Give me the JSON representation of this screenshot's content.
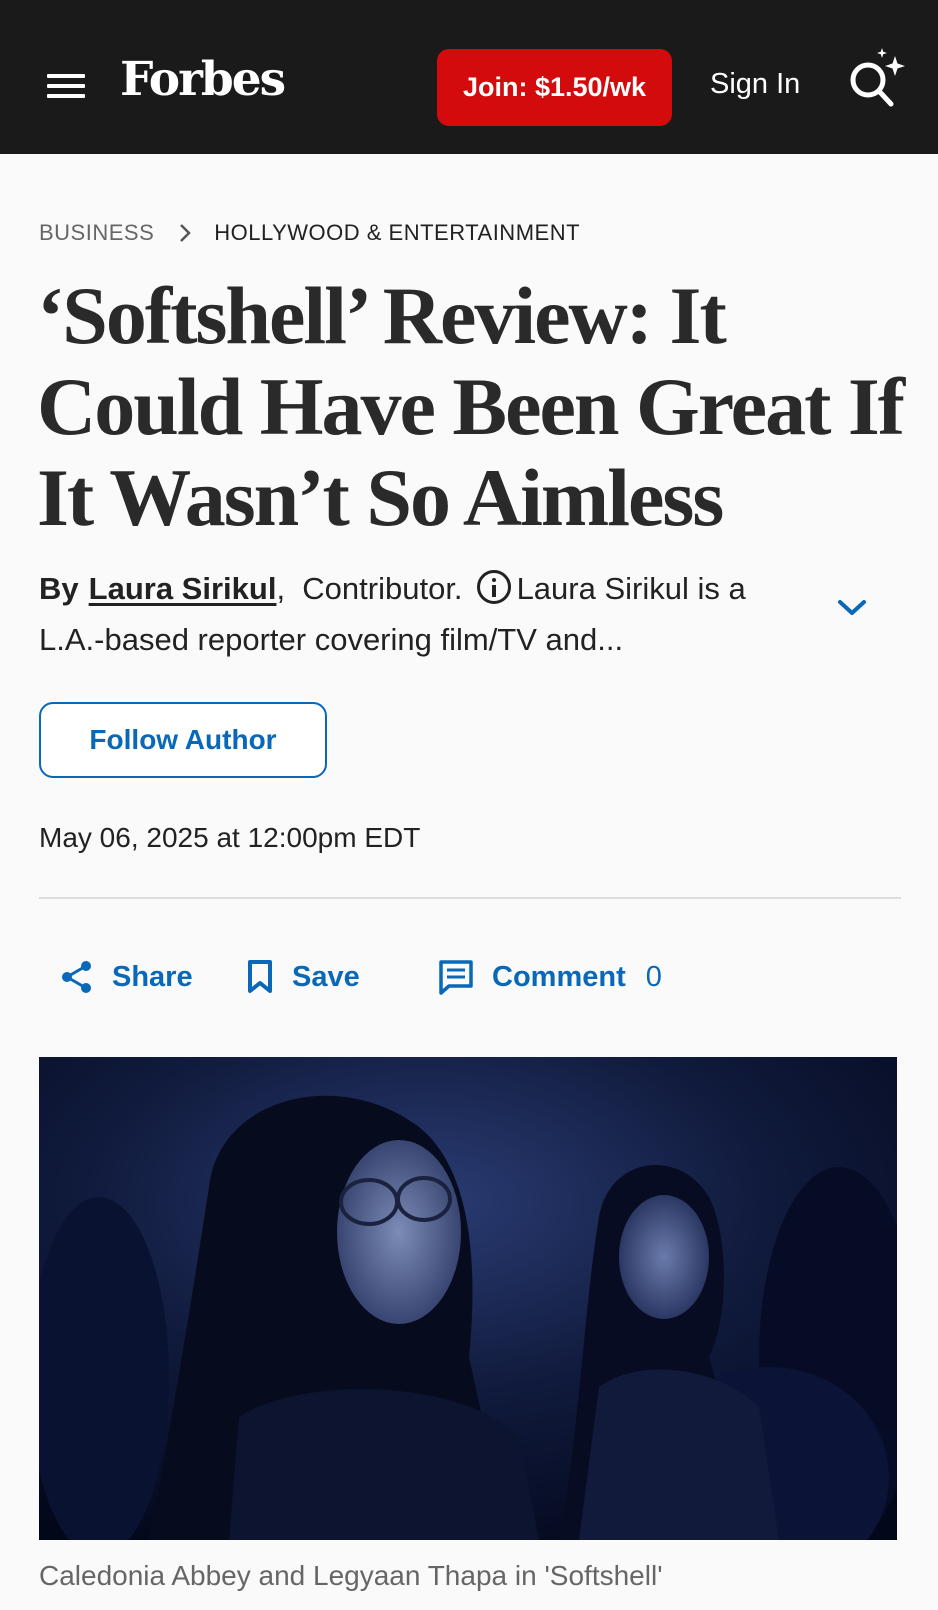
{
  "header": {
    "logo": "Forbes",
    "join_label": "Join: $1.50/wk",
    "signin_label": "Sign In",
    "colors": {
      "background": "#1a1a1a",
      "join": "#d30b0d"
    }
  },
  "breadcrumb": {
    "section": "BUSINESS",
    "subsection": "HOLLYWOOD & ENTERTAINMENT"
  },
  "article": {
    "headline": "‘Softshell’ Review: It Could Have Been Great If It Wasn’t So Aimless",
    "byline": {
      "by": "By",
      "author": "Laura Sirikul",
      "comma": ",",
      "role": "Contributor.",
      "bio": "Laura Sirikul is a L.A.-based reporter covering film/TV and..."
    },
    "follow_label": "Follow Author",
    "date": "May 06, 2025 at 12:00pm EDT",
    "actions": {
      "share": "Share",
      "save": "Save",
      "comment": "Comment",
      "comment_count": "0"
    },
    "image_caption": "Caledonia Abbey and Legyaan Thapa in 'Softshell'"
  },
  "colors": {
    "accent": "#0a68b8"
  }
}
